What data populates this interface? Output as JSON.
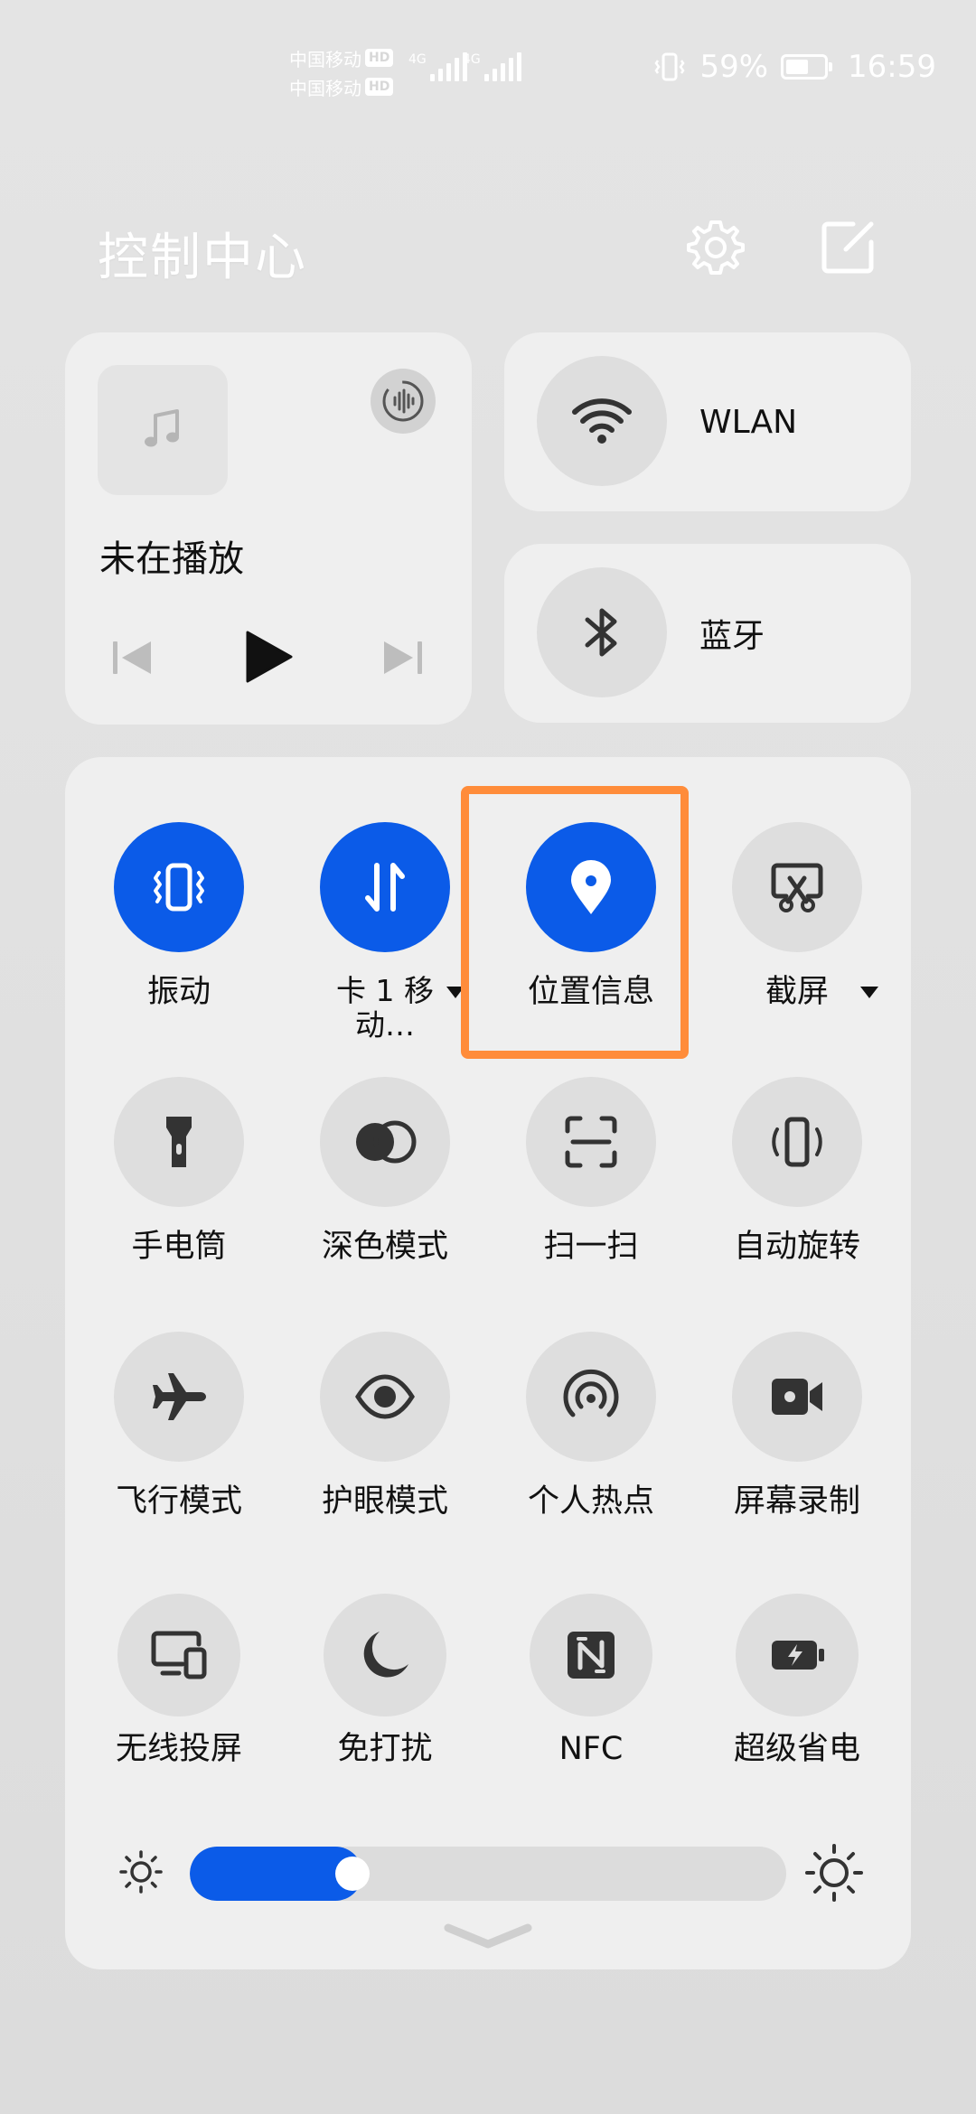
{
  "status_bar": {
    "carrier_1": "中国移动",
    "carrier_2": "中国移动",
    "hd": "HD",
    "network_1": "4G",
    "network_2": "4G",
    "battery_percent": "59%",
    "battery_level": 0.59,
    "time": "16:59"
  },
  "header": {
    "title": "控制中心",
    "settings_icon": "gear-icon",
    "edit_icon": "edit-icon"
  },
  "media": {
    "status": "未在播放",
    "icons": [
      "music-note-icon",
      "audio-output-icon",
      "previous-icon",
      "play-icon",
      "next-icon"
    ]
  },
  "connectivity": {
    "wlan_label": "WLAN",
    "bluetooth_label": "蓝牙"
  },
  "tiles": [
    {
      "label": "振动",
      "icon": "vibrate-icon",
      "active": true
    },
    {
      "label": "卡 1 移\n动…",
      "icon": "mobile-data-icon",
      "active": true,
      "has_menu": true
    },
    {
      "label": "位置信息",
      "icon": "location-pin-icon",
      "active": true
    },
    {
      "label": "截屏",
      "icon": "screenshot-icon",
      "active": false,
      "has_menu": true
    },
    {
      "label": "手电筒",
      "icon": "flashlight-icon",
      "active": false
    },
    {
      "label": "深色模式",
      "icon": "dark-mode-icon",
      "active": false
    },
    {
      "label": "扫一扫",
      "icon": "scan-icon",
      "active": false
    },
    {
      "label": "自动旋转",
      "icon": "auto-rotate-icon",
      "active": false
    },
    {
      "label": "飞行模式",
      "icon": "airplane-icon",
      "active": false
    },
    {
      "label": "护眼模式",
      "icon": "eye-icon",
      "active": false
    },
    {
      "label": "个人热点",
      "icon": "hotspot-icon",
      "active": false
    },
    {
      "label": "屏幕录制",
      "icon": "screen-record-icon",
      "active": false
    },
    {
      "label": "无线投屏",
      "icon": "wireless-projection-icon",
      "active": false
    },
    {
      "label": "免打扰",
      "icon": "moon-icon",
      "active": false
    },
    {
      "label": "NFC",
      "icon": "nfc-icon",
      "active": false
    },
    {
      "label": "超级省电",
      "icon": "power-saving-icon",
      "active": false
    }
  ],
  "brightness": {
    "level": 0.29
  },
  "colors": {
    "accent": "#0b5be8",
    "highlight": "#ff8c3a"
  }
}
